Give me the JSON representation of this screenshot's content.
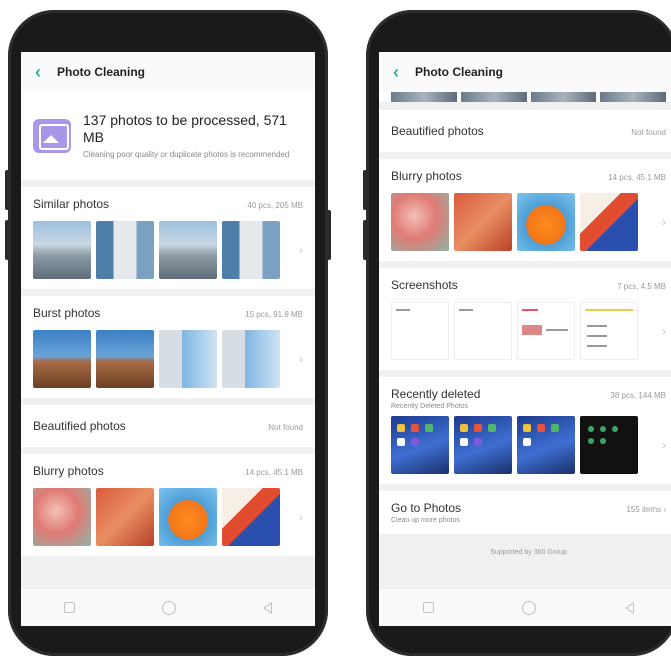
{
  "left": {
    "appbar": {
      "title": "Photo Cleaning"
    },
    "summary": {
      "title": "137 photos to be processed, 571 MB",
      "description": "Cleaning poor quality or duplicate photos is recommended"
    },
    "sections": [
      {
        "title": "Similar photos",
        "meta": "40 pcs, 205 MB"
      },
      {
        "title": "Burst photos",
        "meta": "15 pcs, 91.9 MB"
      },
      {
        "title": "Beautified photos",
        "meta": "Not found"
      },
      {
        "title": "Blurry photos",
        "meta": "14 pcs, 45.1 MB"
      }
    ]
  },
  "right": {
    "appbar": {
      "title": "Photo Cleaning"
    },
    "sections": {
      "beautified": {
        "title": "Beautified photos",
        "meta": "Not found"
      },
      "blurry": {
        "title": "Blurry photos",
        "meta": "14 pcs, 45.1 MB"
      },
      "screenshots": {
        "title": "Screenshots",
        "meta": "7 pcs, 4.5 MB"
      },
      "recently_deleted": {
        "title": "Recently deleted",
        "subtitle": "Recently Deleted Photos",
        "meta": "38 pcs, 144 MB"
      },
      "go_to_photos": {
        "title": "Go to Photos",
        "subtitle": "Clean up more photos",
        "meta": "155 items"
      }
    },
    "footer": "Supported by 360 Group"
  },
  "icons": {
    "back": "chevron-left",
    "more": "chevron-right",
    "gallery": "gallery-icon",
    "nav_recent": "square",
    "nav_home": "circle",
    "nav_back": "triangle"
  },
  "colors": {
    "accent": "#2eb39a",
    "gallery_icon": "#a996e6"
  }
}
